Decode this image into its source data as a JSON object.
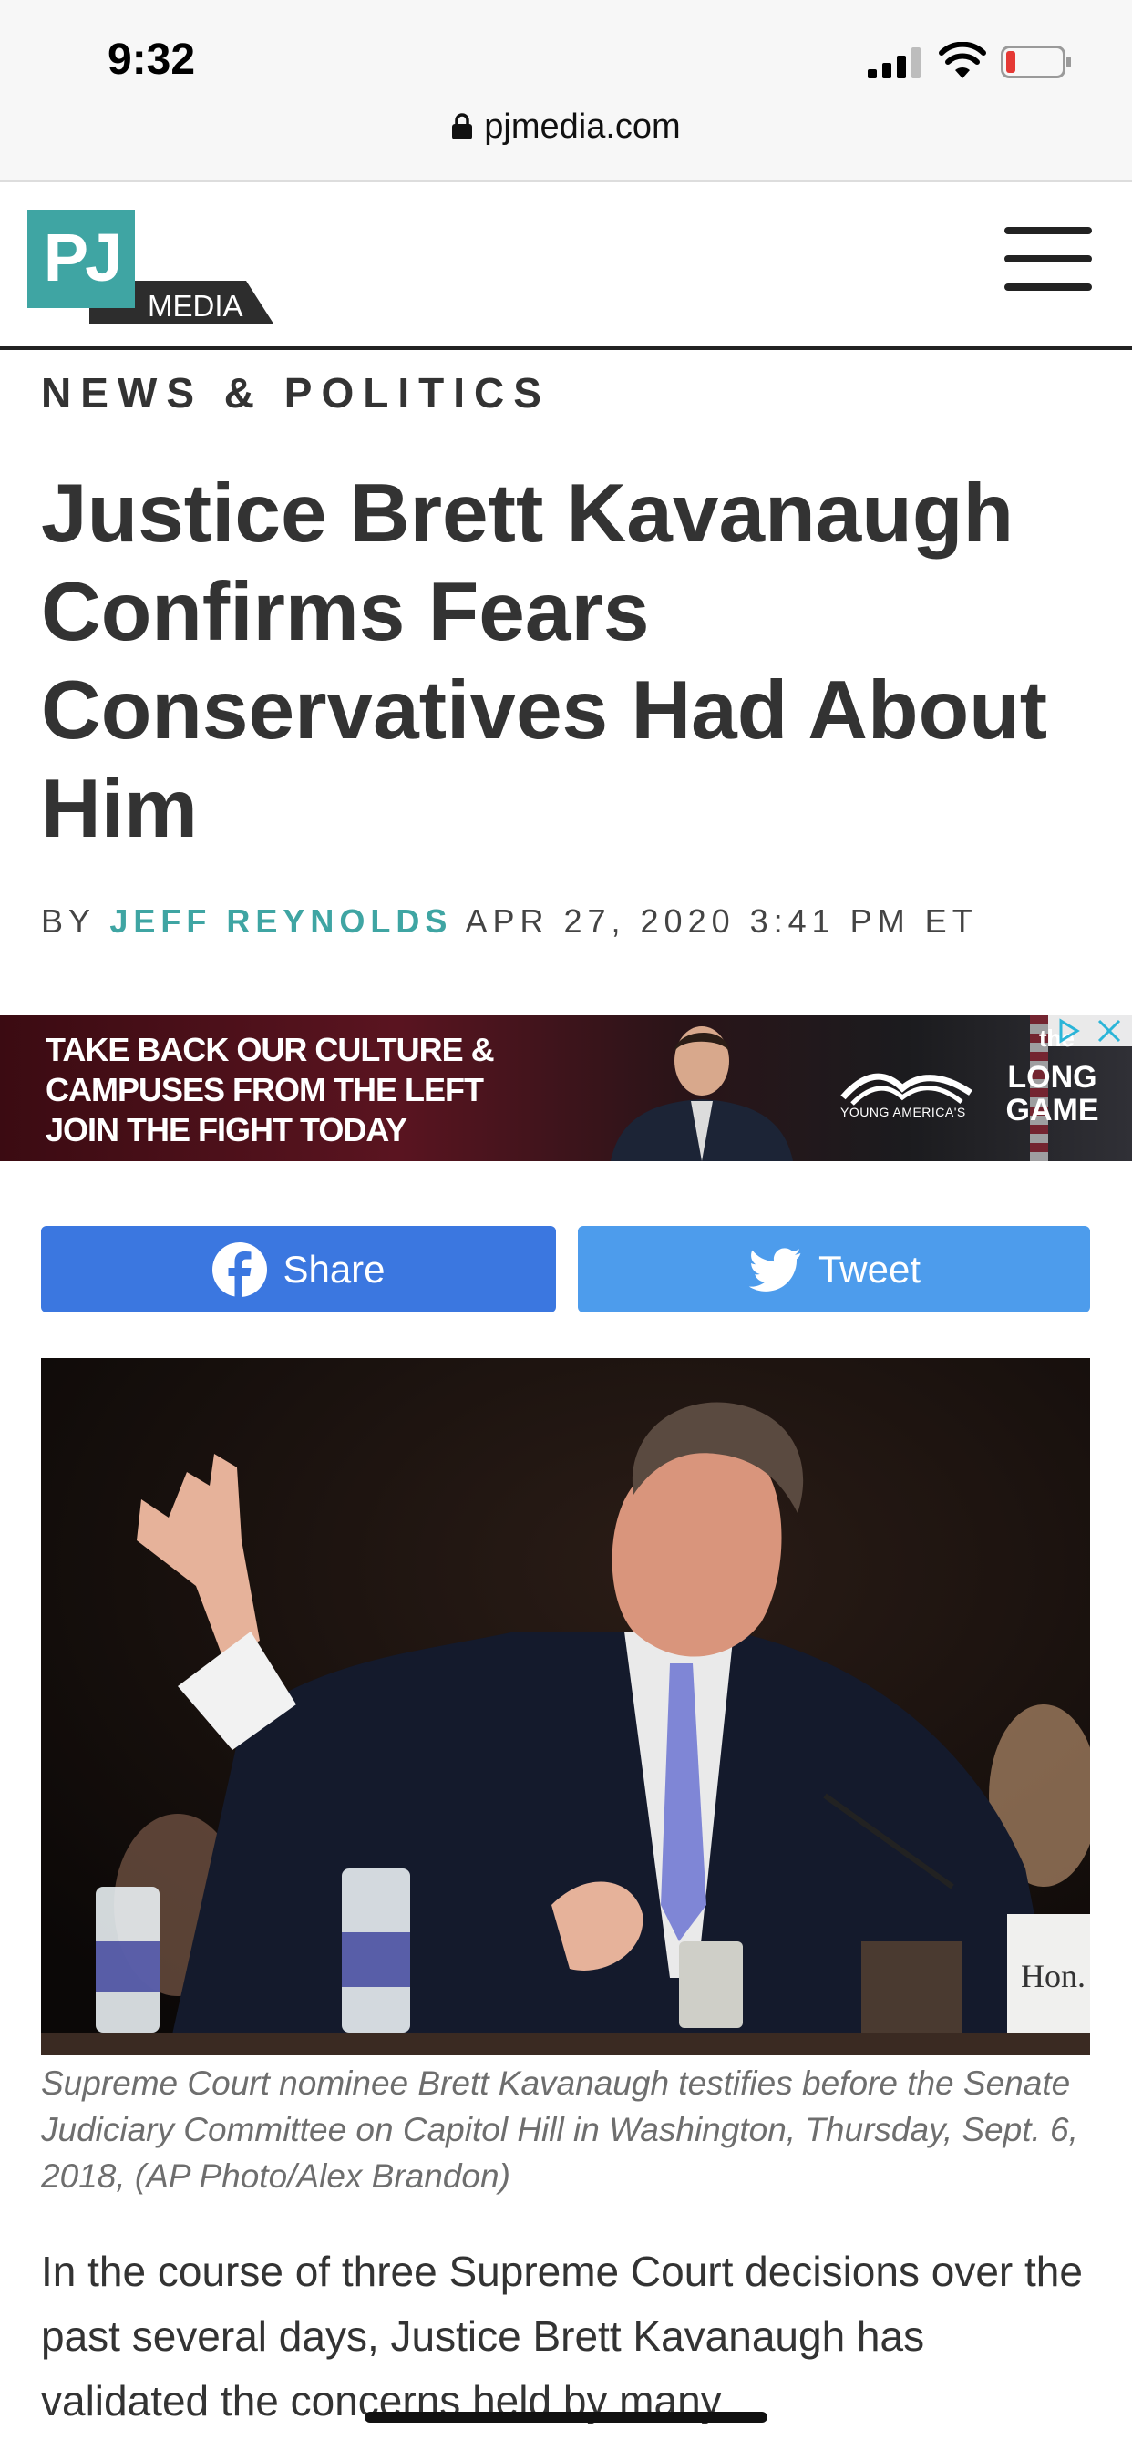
{
  "status_bar": {
    "time": "9:32",
    "url": "pjmedia.com"
  },
  "header": {
    "logo_mark": "PJ",
    "logo_sub": "MEDIA",
    "menu_icon": "hamburger-menu-icon"
  },
  "article": {
    "section": "NEWS & POLITICS",
    "headline": "Justice Brett Kavanaugh Confirms Fears Conservatives Had About Him",
    "byline_prefix": "BY",
    "author": "JEFF REYNOLDS",
    "date": "APR 27, 2020 3:41 PM ET"
  },
  "ad": {
    "line1": "TAKE BACK OUR CULTURE &",
    "line2": "CAMPUSES FROM THE LEFT",
    "line3": "JOIN THE FIGHT TODAY",
    "brand": "YOUNG AMERICA'S",
    "game_the": "the",
    "game_long": "LONG",
    "game_game": "GAME"
  },
  "share": {
    "facebook_label": "Share",
    "twitter_label": "Tweet"
  },
  "photo": {
    "placard_text": "Hon."
  },
  "caption": "Supreme Court nominee Brett Kavanaugh testifies before the Senate Judiciary Committee on Capitol Hill in Washington, Thursday, Sept. 6, 2018, (AP Photo/Alex Brandon)",
  "body_start": "In the course of three Supreme Court decisions over the past several days, Justice Brett Kavanaugh has validated the  concerns held by many",
  "colors": {
    "logo_teal": "#3fa5a3",
    "author_teal": "#3fa5a3",
    "facebook_blue": "#3b77e0",
    "twitter_blue": "#4d9cec",
    "headline_text": "#333333"
  }
}
